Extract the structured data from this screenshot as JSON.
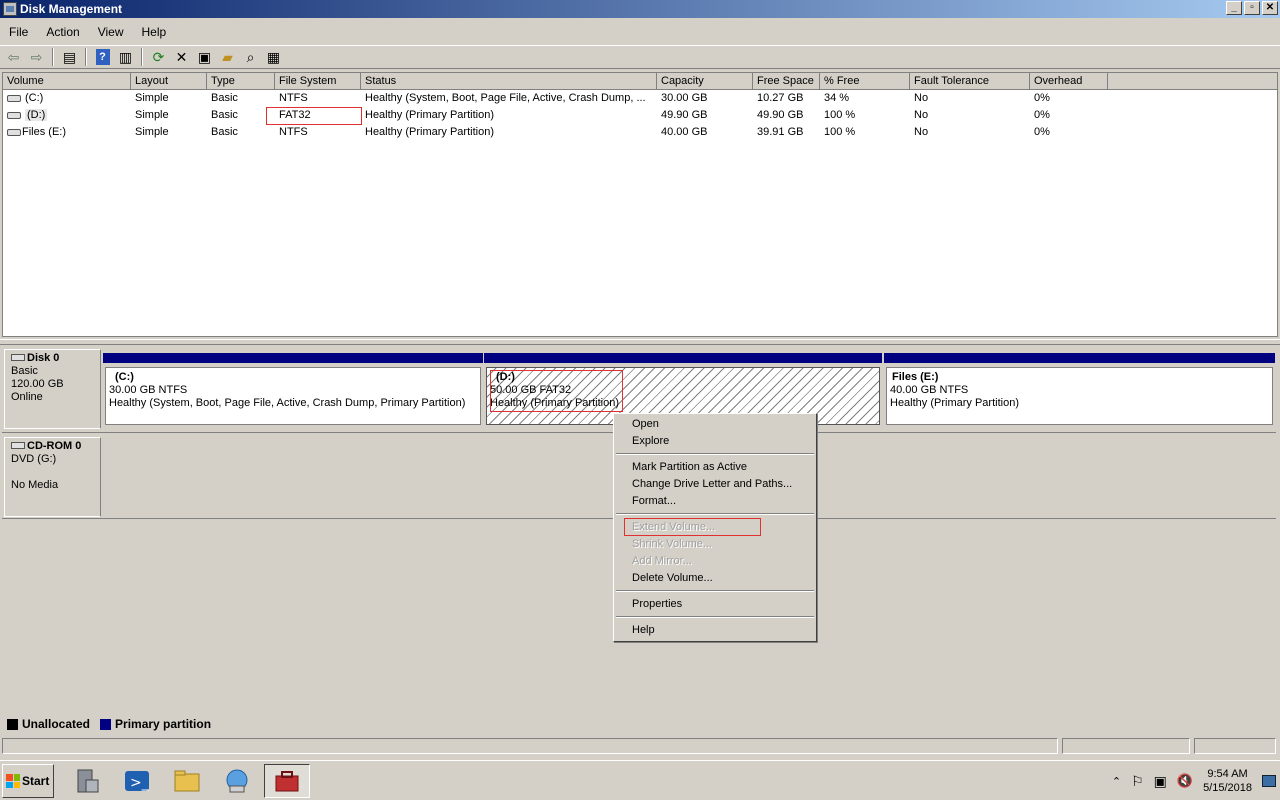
{
  "window": {
    "title": "Disk Management"
  },
  "menu": [
    "File",
    "Action",
    "View",
    "Help"
  ],
  "toolbar": {
    "buttons": [
      "back-arrow-icon",
      "forward-arrow-icon",
      "show-hide-console-tree-icon",
      "help-icon",
      "properties-pane-icon",
      "refresh-icon",
      "delete-icon",
      "properties-icon",
      "open-folder-icon",
      "explore-icon",
      "disk-settings-icon"
    ]
  },
  "volumes": {
    "columns": [
      "Volume",
      "Layout",
      "Type",
      "File System",
      "Status",
      "Capacity",
      "Free Space",
      "% Free",
      "Fault Tolerance",
      "Overhead"
    ],
    "rows": [
      [
        "(C:)",
        "Simple",
        "Basic",
        "NTFS",
        "Healthy (System, Boot, Page File, Active, Crash Dump, ...",
        "30.00 GB",
        "10.27 GB",
        "34 %",
        "No",
        "0%"
      ],
      [
        "(D:)",
        "Simple",
        "Basic",
        "FAT32",
        "Healthy (Primary Partition)",
        "49.90 GB",
        "49.90 GB",
        "100 %",
        "No",
        "0%"
      ],
      [
        "Files (E:)",
        "Simple",
        "Basic",
        "NTFS",
        "Healthy (Primary Partition)",
        "40.00 GB",
        "39.91 GB",
        "100 %",
        "No",
        "0%"
      ]
    ]
  },
  "disks": [
    {
      "name": "Disk 0",
      "type": "Basic",
      "size": "120.00 GB",
      "state": "Online",
      "partitions": [
        {
          "name": "(C:)",
          "size_fs": "30.00 GB NTFS",
          "status": "Healthy (System, Boot, Page File, Active, Crash Dump, Primary Partition)"
        },
        {
          "name": "(D:)",
          "size_fs": "50.00 GB FAT32",
          "status": "Healthy (Primary Partition)"
        },
        {
          "name": "Files  (E:)",
          "size_fs": "40.00 GB NTFS",
          "status": "Healthy (Primary Partition)"
        }
      ]
    },
    {
      "name": "CD-ROM 0",
      "type": "DVD (G:)",
      "size": "",
      "state": "No Media"
    }
  ],
  "legend": [
    {
      "label": "Unallocated",
      "color": "#000000"
    },
    {
      "label": "Primary partition",
      "color": "#000080"
    }
  ],
  "context_menu": {
    "open": "Open",
    "explore": "Explore",
    "mark_active": "Mark Partition as Active",
    "change_letter": "Change Drive Letter and Paths...",
    "format": "Format...",
    "extend": "Extend Volume...",
    "shrink": "Shrink Volume...",
    "add_mirror": "Add Mirror...",
    "delete": "Delete Volume...",
    "properties": "Properties",
    "help": "Help"
  },
  "taskbar": {
    "start": "Start",
    "apps": [
      "server-manager-icon",
      "powershell-icon",
      "file-explorer-icon",
      "network-icon",
      "computer-management-icon"
    ],
    "time": "9:54 AM",
    "date": "5/15/2018"
  },
  "colors": {
    "title_start": "#0a246a",
    "title_end": "#a6caf0",
    "partition_bar": "#000080",
    "highlight_box": "#e03030",
    "face": "#d4d0c8"
  }
}
